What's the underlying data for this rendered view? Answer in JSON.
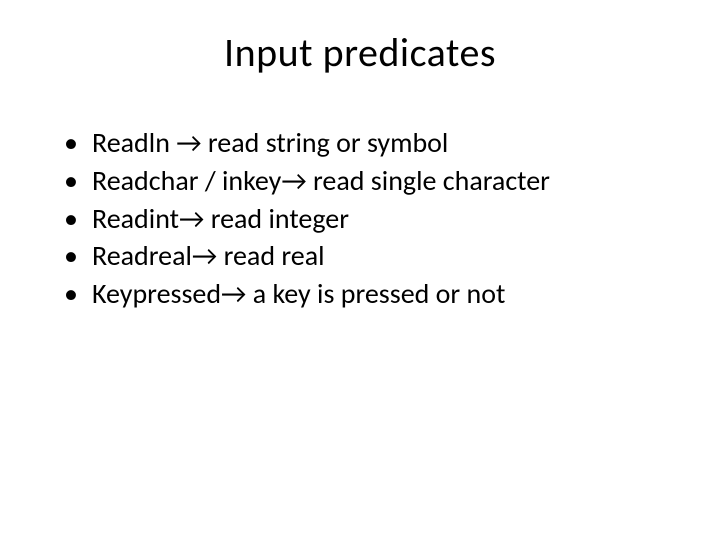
{
  "title": "Input  predicates",
  "bullets": [
    {
      "text": "Readln → read string or symbol"
    },
    {
      "text": "Readchar / inkey→ read  single character"
    },
    {
      "text": "Readint→ read integer"
    },
    {
      "text": "Readreal→ read real"
    },
    {
      "text": "Keypressed→ a key is pressed or not"
    }
  ]
}
